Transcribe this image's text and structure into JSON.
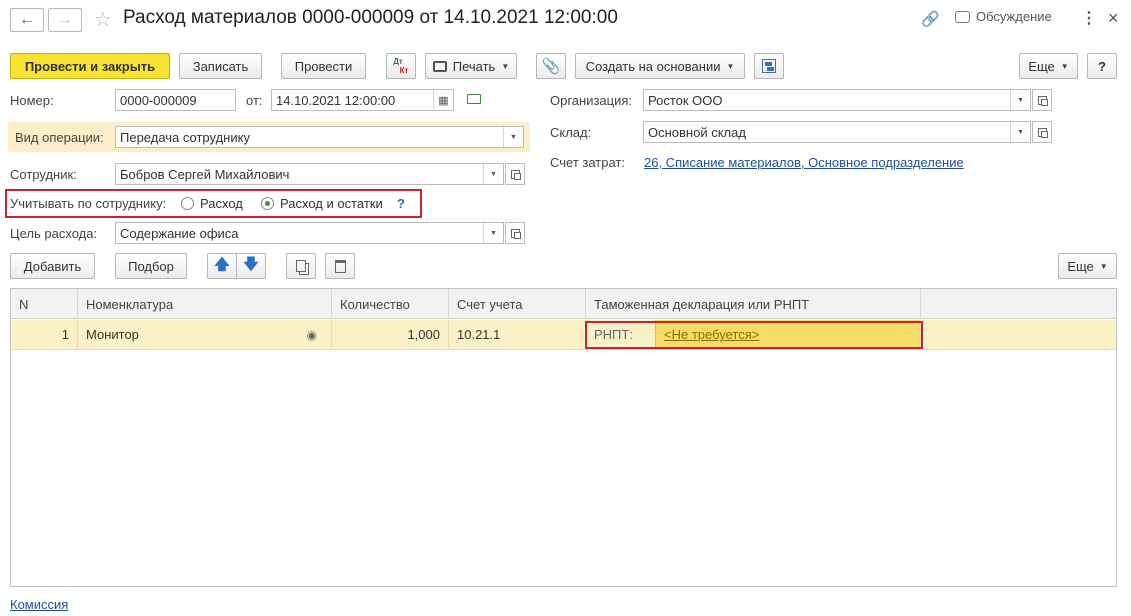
{
  "window": {
    "title": "Расход материалов 0000-000009 от 14.10.2021 12:00:00",
    "discussion_label": "Обсуждение"
  },
  "toolbar": {
    "post_close": "Провести и закрыть",
    "save": "Записать",
    "post": "Провести",
    "dtkt_top": "Дт",
    "dtkt_bottom": "Кт",
    "print": "Печать",
    "create_based": "Создать на основании",
    "more": "Еще",
    "help": "?"
  },
  "form": {
    "number_label": "Номер:",
    "number_value": "0000-000009",
    "date_label": "от:",
    "date_value": "14.10.2021 12:00:00",
    "operation_label": "Вид операции:",
    "operation_value": "Передача сотруднику",
    "employee_label": "Сотрудник:",
    "employee_value": "Бобров Сергей Михайлович",
    "account_by_employee_label": "Учитывать по сотруднику:",
    "radio_expense": "Расход",
    "radio_expense_balance": "Расход и остатки",
    "radio_help": "?",
    "purpose_label": "Цель расхода:",
    "purpose_value": "Содержание офиса",
    "org_label": "Организация:",
    "org_value": "Росток ООО",
    "warehouse_label": "Склад:",
    "warehouse_value": "Основной склад",
    "cost_account_label": "Счет затрат:",
    "cost_account_value": "26, Списание материалов, Основное подразделение"
  },
  "table_toolbar": {
    "add": "Добавить",
    "pick": "Подбор",
    "more": "Еще"
  },
  "table": {
    "columns": [
      "N",
      "Номенклатура",
      "Количество",
      "Счет учета",
      "Таможенная декларация или РНПТ"
    ],
    "rows": [
      {
        "n": "1",
        "item": "Монитор",
        "qty": "1,000",
        "account": "10.21.1",
        "rnpt_label": "РНПТ:",
        "rnpt_value": "<Не требуется>"
      }
    ]
  },
  "footer": {
    "commission_link": "Комиссия"
  },
  "colors": {
    "primary_button": "#f9e332",
    "highlight_row": "#fbf1c7",
    "operation_row_bg": "#fbeec8",
    "red_outline": "#cf2030",
    "link": "#1f4f9c"
  }
}
